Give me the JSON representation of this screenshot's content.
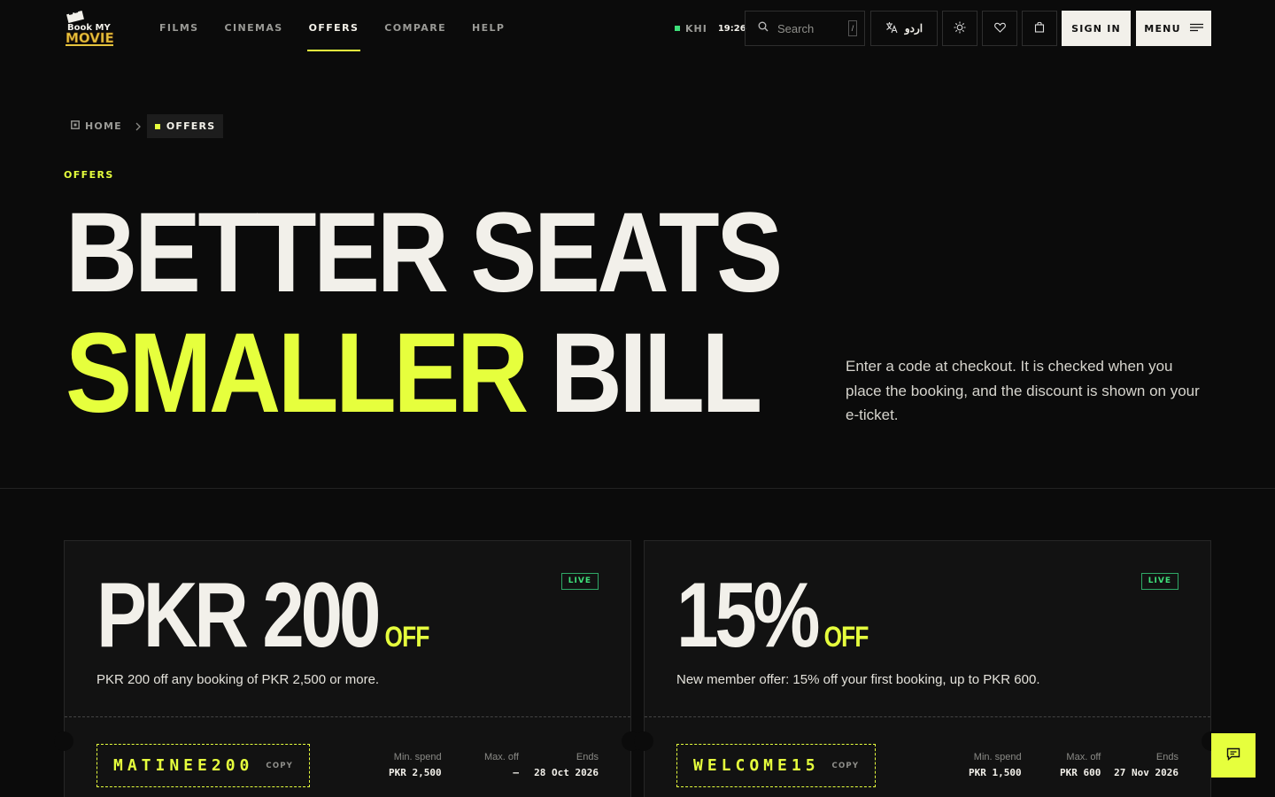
{
  "brand": {
    "logo_text_1": "Book MY",
    "logo_text_2": "MOVIE"
  },
  "nav": {
    "items": [
      {
        "label": "FILMS"
      },
      {
        "label": "CINEMAS"
      },
      {
        "label": "OFFERS"
      },
      {
        "label": "COMPARE"
      },
      {
        "label": "HELP"
      }
    ],
    "active": "OFFERS"
  },
  "clock": {
    "city": "KHI",
    "time": "19:26"
  },
  "search": {
    "placeholder": "Search",
    "shortcut": "/"
  },
  "language": {
    "label": "اردو"
  },
  "actions": {
    "sign_in": "SIGN IN",
    "menu": "MENU"
  },
  "breadcrumb": {
    "home": "HOME",
    "current": "OFFERS"
  },
  "hero": {
    "eyebrow": "OFFERS",
    "line1": "BETTER SEATS",
    "line2_accent": "SMALLER",
    "line2_rest": "BILL",
    "lead": "Enter a code at checkout. It is checked when you place the booking, and the discount is shown on your e-ticket."
  },
  "offers": [
    {
      "amount": "PKR 200",
      "off": "OFF",
      "status": "LIVE",
      "description": "PKR 200 off any booking of PKR 2,500 or more.",
      "code": "MATINEE200",
      "copy": "COPY",
      "min_spend_label": "Min. spend",
      "min_spend": "PKR 2,500",
      "max_off_label": "Max. off",
      "max_off": "–",
      "ends_label": "Ends",
      "ends": "28 Oct 2026"
    },
    {
      "amount": "15%",
      "off": "OFF",
      "status": "LIVE",
      "description": "New member offer: 15% off your first booking, up to PKR 600.",
      "code": "WELCOME15",
      "copy": "COPY",
      "min_spend_label": "Min. spend",
      "min_spend": "PKR 1,500",
      "max_off_label": "Max. off",
      "max_off": "PKR 600",
      "ends_label": "Ends",
      "ends": "27 Nov 2026"
    }
  ],
  "colors": {
    "accent": "#e6ff3d",
    "live": "#3ee07a",
    "background": "#0b0b0b"
  },
  "icons": [
    "logo-icon",
    "search-icon",
    "translate-icon",
    "sun-icon",
    "heart-icon",
    "bag-icon",
    "menu-lines-icon",
    "home-icon",
    "chevron-right-icon",
    "chat-icon"
  ]
}
